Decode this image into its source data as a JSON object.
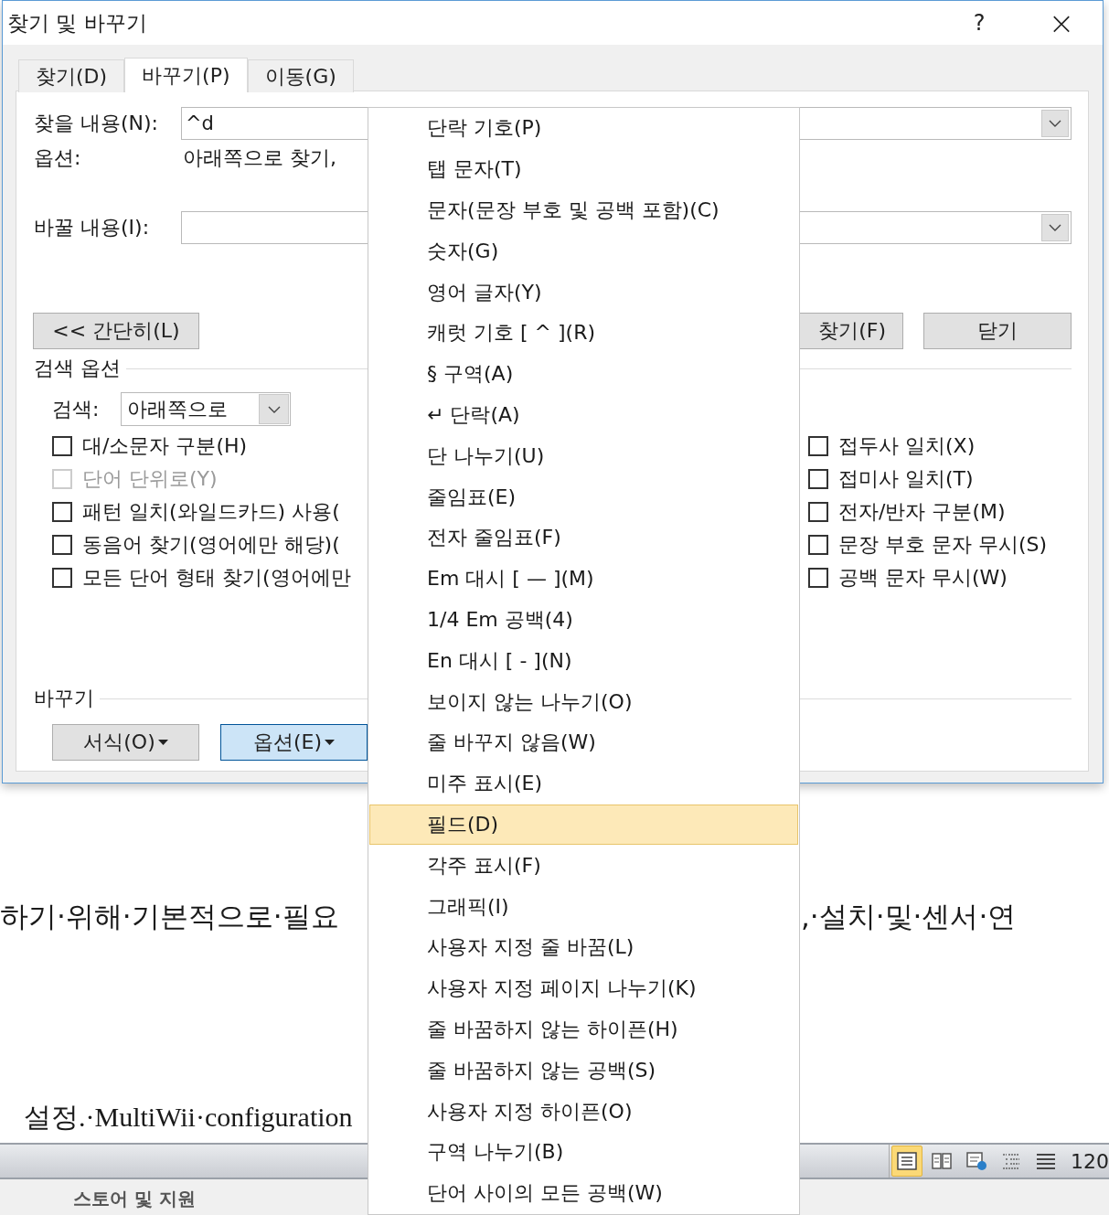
{
  "dialog": {
    "title": "찾기 및 바꾸기",
    "help": "?",
    "close": "×",
    "tabs": [
      {
        "label": "찾기(D)",
        "selected": false
      },
      {
        "label": "바꾸기(P)",
        "selected": true
      },
      {
        "label": "이동(G)",
        "selected": false
      }
    ],
    "find_label": "찾을 내용(N):",
    "find_value": "^d",
    "options_label": "옵션:",
    "options_value": "아래쪽으로 찾기,",
    "replace_label": "바꿀 내용(I):",
    "less_button": "<< 간단히(L)",
    "find_next_button": "찾기(F)",
    "close_button": "닫기",
    "search_options_heading": "검색 옵션",
    "search_label": "검색:",
    "search_value": "아래쪽으로",
    "left_checks": [
      {
        "label": "대/소문자 구분(H)",
        "checked": false,
        "disabled": false
      },
      {
        "label": "단어 단위로(Y)",
        "checked": false,
        "disabled": true
      },
      {
        "label": "패턴 일치(와일드카드) 사용(",
        "checked": false,
        "disabled": false
      },
      {
        "label": "동음어 찾기(영어에만 해당)(",
        "checked": false,
        "disabled": false
      },
      {
        "label": "모든 단어 형태 찾기(영어에만",
        "checked": false,
        "disabled": false
      }
    ],
    "right_checks": [
      {
        "label": "접두사 일치(X)",
        "checked": false,
        "disabled": false
      },
      {
        "label": "접미사 일치(T)",
        "checked": false,
        "disabled": false
      },
      {
        "label": "전자/반자 구분(M)",
        "checked": false,
        "disabled": false
      },
      {
        "label": "문장 부호 문자 무시(S)",
        "checked": false,
        "disabled": false
      },
      {
        "label": "공백 문자 무시(W)",
        "checked": false,
        "disabled": false
      }
    ],
    "replace_heading": "바꾸기",
    "bottom_buttons": [
      {
        "label": "서식(O)",
        "open": false
      },
      {
        "label": "옵션(E)",
        "open": true
      }
    ]
  },
  "document": {
    "line_1_left": "하기·위해·기본적으로·필요",
    "line_1_right": ",·설치·및·센서·연",
    "line_2": "설정.·MultiWii·configuration"
  },
  "status_bar": {
    "views": [
      {
        "kind": "print",
        "selected": true
      },
      {
        "kind": "read",
        "selected": false
      },
      {
        "kind": "web",
        "selected": false
      },
      {
        "kind": "outline",
        "selected": false
      },
      {
        "kind": "draft",
        "selected": false
      }
    ],
    "zoom": "120"
  },
  "footer": {
    "heading": "스토어 및 지원"
  },
  "menu": {
    "items": [
      {
        "label": "단락 기호(P)",
        "selected": false
      },
      {
        "label": "탭 문자(T)",
        "selected": false
      },
      {
        "label": "문자(문장 부호 및 공백 포함)(C)",
        "selected": false
      },
      {
        "label": "숫자(G)",
        "selected": false
      },
      {
        "label": "영어 글자(Y)",
        "selected": false
      },
      {
        "label": "캐럿 기호 [ ^ ](R)",
        "selected": false
      },
      {
        "label": "§ 구역(A)",
        "selected": false
      },
      {
        "label": "↵ 단락(A)",
        "selected": false
      },
      {
        "label": "단 나누기(U)",
        "selected": false
      },
      {
        "label": "줄임표(E)",
        "selected": false
      },
      {
        "label": "전자 줄임표(F)",
        "selected": false
      },
      {
        "label": "Em 대시 [ — ](M)",
        "selected": false
      },
      {
        "label": "1/4 Em 공백(4)",
        "selected": false
      },
      {
        "label": "En 대시 [ - ](N)",
        "selected": false
      },
      {
        "label": "보이지 않는 나누기(O)",
        "selected": false
      },
      {
        "label": "줄 바꾸지 않음(W)",
        "selected": false
      },
      {
        "label": "미주 표시(E)",
        "selected": false
      },
      {
        "label": "필드(D)",
        "selected": true
      },
      {
        "label": "각주 표시(F)",
        "selected": false
      },
      {
        "label": "그래픽(I)",
        "selected": false
      },
      {
        "label": "사용자 지정 줄 바꿈(L)",
        "selected": false
      },
      {
        "label": "사용자 지정 페이지 나누기(K)",
        "selected": false
      },
      {
        "label": "줄 바꿈하지 않는 하이픈(H)",
        "selected": false
      },
      {
        "label": "줄 바꿈하지 않는 공백(S)",
        "selected": false
      },
      {
        "label": "사용자 지정 하이픈(O)",
        "selected": false
      },
      {
        "label": "구역 나누기(B)",
        "selected": false
      },
      {
        "label": "단어 사이의 모든 공백(W)",
        "selected": false
      }
    ]
  }
}
